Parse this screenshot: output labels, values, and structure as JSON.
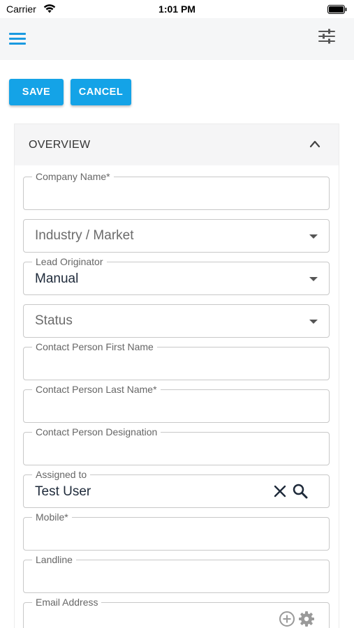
{
  "status_bar": {
    "carrier": "Carrier",
    "time": "1:01 PM"
  },
  "header": {
    "menu_icon": "hamburger-icon",
    "filter_icon": "sliders-icon"
  },
  "actions": {
    "save_label": "SAVE",
    "cancel_label": "CANCEL"
  },
  "colors": {
    "accent": "#14a3e7",
    "menu_icon": "#1a9ae0"
  },
  "overview": {
    "title": "OVERVIEW",
    "fields": {
      "company_name": {
        "label": "Company Name*",
        "value": ""
      },
      "industry": {
        "placeholder": "Industry / Market"
      },
      "lead_originator": {
        "label": "Lead Originator",
        "value": "Manual"
      },
      "status": {
        "placeholder": "Status"
      },
      "contact_first": {
        "label": "Contact Person First Name",
        "value": ""
      },
      "contact_last": {
        "label": "Contact Person Last Name*",
        "value": ""
      },
      "contact_designation": {
        "label": "Contact Person Designation",
        "value": ""
      },
      "assigned_to": {
        "label": "Assigned to",
        "value": "Test User"
      },
      "mobile": {
        "label": "Mobile*",
        "value": ""
      },
      "landline": {
        "label": "Landline",
        "value": ""
      },
      "email": {
        "label": "Email Address",
        "value": ""
      }
    }
  }
}
